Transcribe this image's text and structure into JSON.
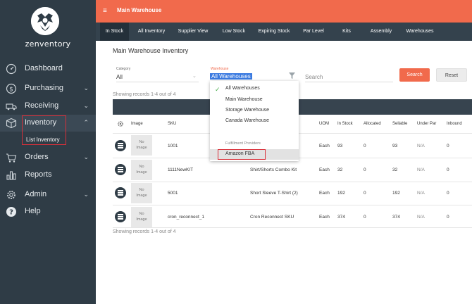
{
  "brand": {
    "logo_text": "zenventory"
  },
  "sidebar": {
    "items": [
      {
        "label": "Dashboard",
        "icon": "gauge-icon",
        "chevron": ""
      },
      {
        "label": "Purchasing",
        "icon": "dollar-circle-icon",
        "chevron": "⌄"
      },
      {
        "label": "Receiving",
        "icon": "truck-icon",
        "chevron": "⌄"
      },
      {
        "label": "Inventory",
        "icon": "box-icon",
        "chevron": "⌃"
      },
      {
        "label": "Orders",
        "icon": "cart-icon",
        "chevron": "⌄"
      },
      {
        "label": "Reports",
        "icon": "bar-chart-icon",
        "chevron": ""
      },
      {
        "label": "Admin",
        "icon": "gear-icon",
        "chevron": "⌄"
      },
      {
        "label": "Help",
        "icon": "question-circle-icon",
        "chevron": ""
      }
    ],
    "sub_item": "List Inventory"
  },
  "topbar": {
    "menu_icon": "≡",
    "title": "Main Warehouse"
  },
  "tabs": [
    "In Stock",
    "All Inventory",
    "Supplier View",
    "Low Stock",
    "Expiring Stock",
    "Par Level",
    "Kits",
    "Assembly",
    "Warehouses"
  ],
  "page_title": "Main Warehouse Inventory",
  "filters": {
    "category_label": "Category",
    "category_value": "All",
    "warehouse_label": "Warehouse",
    "warehouse_value": "All Warehouses",
    "search_placeholder": "Search",
    "search_button": "Search",
    "reset_button": "Reset"
  },
  "records_text": "Showing records 1-4 out of 4",
  "dropdown": {
    "options": [
      "All Warehouses",
      "Main Warehouse",
      "Storage Warehouse",
      "Canada Warehouse"
    ],
    "group_label": "Fulfillment Providers",
    "provider_options": [
      "Amazon FBA"
    ]
  },
  "table": {
    "headers": [
      "Image",
      "SKU",
      "UOM",
      "In Stock",
      "Allocated",
      "Sellable",
      "Under Par",
      "Inbound"
    ],
    "no_image": [
      "No",
      "Image"
    ],
    "rows": [
      {
        "sku": "1001",
        "desc": "",
        "uom": "Each",
        "in_stock": "93",
        "allocated": "0",
        "sellable": "93",
        "under_par": "N/A",
        "inbound": "0"
      },
      {
        "sku": "1111NewKIT",
        "desc": "Shirt/Shorts Combo Kit",
        "uom": "Each",
        "in_stock": "32",
        "allocated": "0",
        "sellable": "32",
        "under_par": "N/A",
        "inbound": "0"
      },
      {
        "sku": "5001",
        "desc": "Short Sleeve T-Shirt (2)",
        "uom": "Each",
        "in_stock": "192",
        "allocated": "0",
        "sellable": "192",
        "under_par": "N/A",
        "inbound": "0"
      },
      {
        "sku": "cron_reconnect_1",
        "desc": "Cron Reconnect SKU",
        "uom": "Each",
        "in_stock": "374",
        "allocated": "0",
        "sellable": "374",
        "under_par": "N/A",
        "inbound": "0"
      }
    ]
  },
  "colors": {
    "accent": "#f16a4c",
    "sidebar": "#2f3c46",
    "highlight": "#d9303a",
    "check": "#4caf50"
  }
}
